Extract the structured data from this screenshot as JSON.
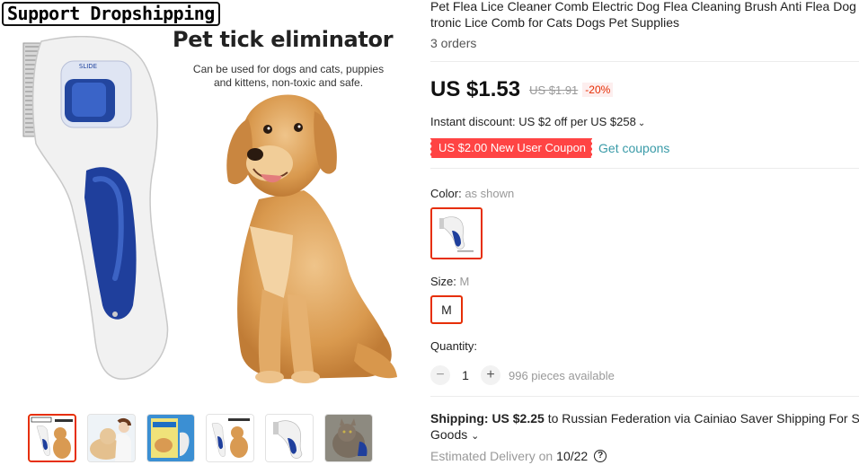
{
  "gallery": {
    "badge_text": "Support Dropshipping",
    "headline": "Pet tick eliminator",
    "subtitle": "Can be used for dogs and cats, puppies and kittens, non-toxic and safe.",
    "device_label": "SLIDE",
    "thumbnails": [
      {
        "subject": "comb-with-dog",
        "active": true
      },
      {
        "subject": "woman-with-dog",
        "active": false
      },
      {
        "subject": "product-box",
        "active": false
      },
      {
        "subject": "comb-with-dog-alt",
        "active": false
      },
      {
        "subject": "comb-only",
        "active": false
      },
      {
        "subject": "cat-with-comb",
        "active": false
      }
    ]
  },
  "product": {
    "title": "Pet Flea Lice Cleaner Comb Electric Dog Flea Cleaning Brush Anti Flea Dog tronic Lice Comb for Cats Dogs Pet Supplies",
    "orders": "3 orders",
    "price": "US $1.53",
    "original_price": "US $1.91",
    "discount": "-20%",
    "instant_discount": "Instant discount: US $2 off per US $258",
    "coupon": "US $2.00 New User Coupon",
    "get_coupons": "Get coupons",
    "color_label": "Color:",
    "color_value": "as shown",
    "size_label": "Size:",
    "size_value": "M",
    "size_option": "M",
    "quantity_label": "Quantity:",
    "quantity": "1",
    "available": "996 pieces available",
    "shipping_label": "Shipping:",
    "shipping_price": "US $2.25",
    "shipping_text": "to Russian Federation via Cainiao Saver Shipping For S Goods",
    "delivery_label": "Estimated Delivery on",
    "delivery_date": "10/22"
  },
  "colors": {
    "accent_red": "#e62e04",
    "coupon_bg": "#ff4444",
    "link_teal": "#3a9ba8",
    "device_blue": "#1f3f9c"
  }
}
